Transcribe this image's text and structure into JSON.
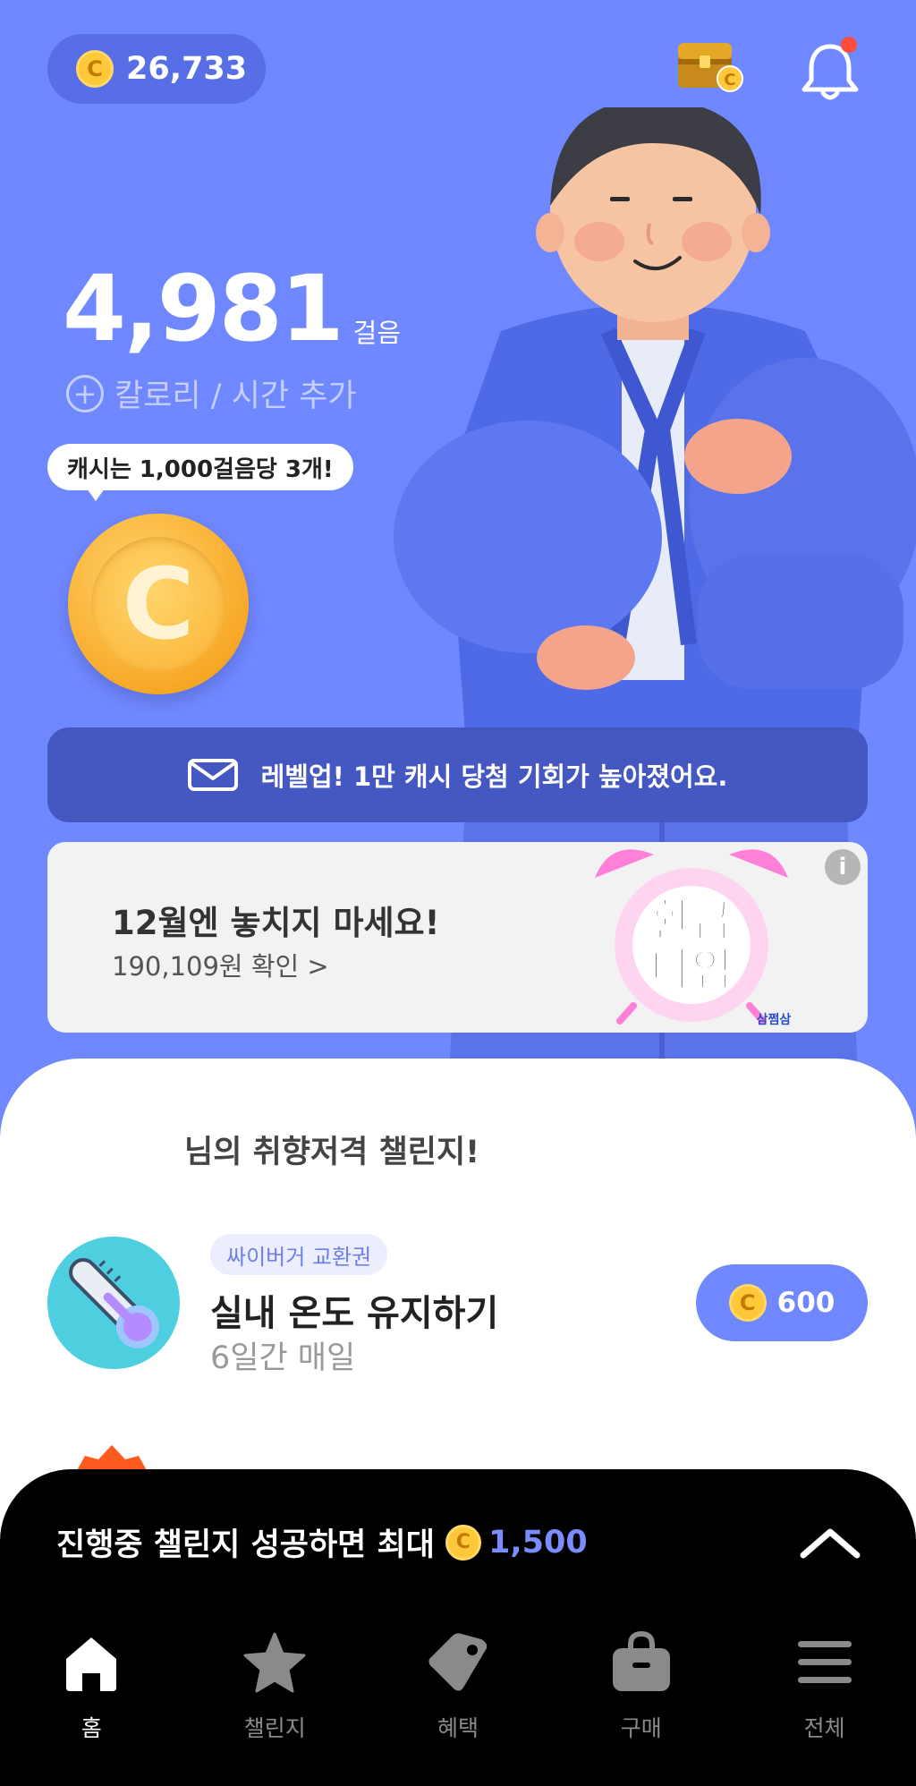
{
  "header": {
    "balance": "26,733",
    "coin_symbol": "C"
  },
  "steps": {
    "count": "4,981",
    "unit": "걸음",
    "add_label": "칼로리 / 시간 추가"
  },
  "bubble": {
    "text": "캐시는 1,000걸음당 3개!"
  },
  "big_coin": {
    "symbol": "C"
  },
  "levelup_banner": {
    "text": "레벨업! 1만 캐시 당첨 기회가 높아졌어요."
  },
  "ad": {
    "title": "12월엔 놓치지 마세요!",
    "subtitle": "190,109원 확인 >",
    "info": "i",
    "art_line1": "환급",
    "art_line2": "타임",
    "brand": "삼쩜삼"
  },
  "challenge_section": {
    "title": "님의 취향저격 챌린지!",
    "item": {
      "tag": "싸이버거 교환권",
      "name": "실내 온도 유지하기",
      "period": "6일간 매일",
      "reward": "600",
      "coin_symbol": "C"
    }
  },
  "bottom_sheet": {
    "promo_text": "진행중 챌린지 성공하면 최대",
    "promo_amount": "1,500",
    "coin_symbol": "C"
  },
  "nav": {
    "home": "홈",
    "challenge": "챌린지",
    "benefit": "혜택",
    "purchase": "구매",
    "all": "전체"
  },
  "colors": {
    "background": "#6f87ff",
    "accent": "#6f87ff",
    "banner": "#4557c0",
    "coin": "#ffc83a"
  }
}
